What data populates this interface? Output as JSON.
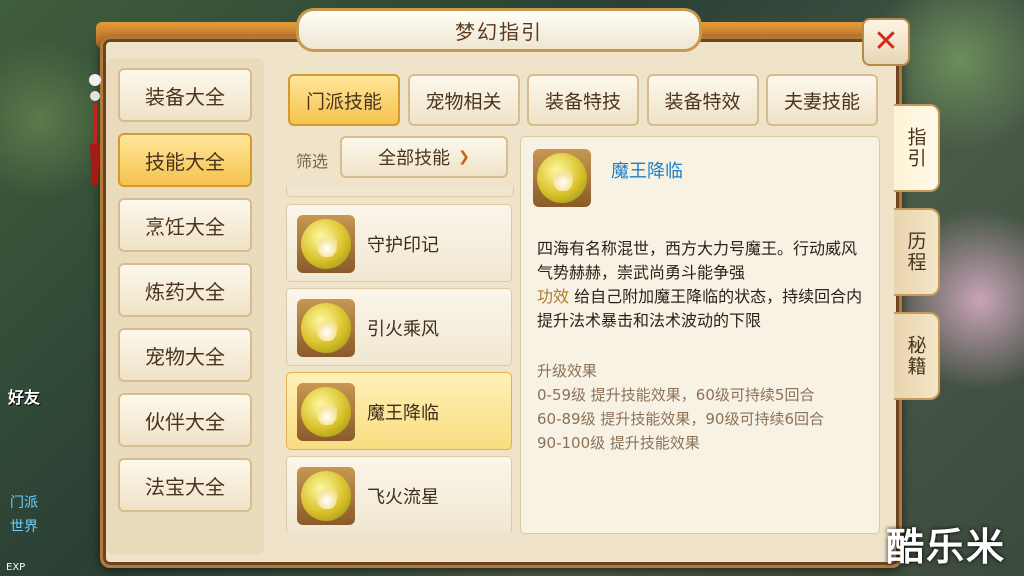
{
  "window": {
    "title": "梦幻指引",
    "close_label": "✕"
  },
  "categories": [
    {
      "label": "装备大全",
      "active": false
    },
    {
      "label": "技能大全",
      "active": true
    },
    {
      "label": "烹饪大全",
      "active": false
    },
    {
      "label": "炼药大全",
      "active": false
    },
    {
      "label": "宠物大全",
      "active": false
    },
    {
      "label": "伙伴大全",
      "active": false
    },
    {
      "label": "法宝大全",
      "active": false
    }
  ],
  "tabs": [
    {
      "label": "门派技能",
      "active": true
    },
    {
      "label": "宠物相关",
      "active": false
    },
    {
      "label": "装备特技",
      "active": false
    },
    {
      "label": "装备特效",
      "active": false
    },
    {
      "label": "夫妻技能",
      "active": false
    }
  ],
  "filter": {
    "label": "筛选",
    "value": "全部技能"
  },
  "skills": [
    {
      "name": "守护印记",
      "active": false
    },
    {
      "name": "引火乘风",
      "active": false
    },
    {
      "name": "魔王降临",
      "active": true
    },
    {
      "name": "飞火流星",
      "active": false
    }
  ],
  "detail": {
    "name": "魔王降临",
    "description": "四海有名称混世，西方大力号魔王。行动威风气势赫赫，崇武尚勇斗能争强",
    "effect_key": "功效",
    "effect_text": " 给自己附加魔王降临的状态，持续回合内提升法术暴击和法术波动的下限",
    "upgrade_title": "升级效果",
    "upgrade_lines": [
      "0-59级 提升技能效果，60级可持续5回合",
      "60-89级 提升技能效果，90级可持续6回合",
      "90-100级 提升技能效果"
    ]
  },
  "side_tabs": [
    {
      "label": "指引",
      "active": true
    },
    {
      "label": "历程",
      "active": false
    },
    {
      "label": "秘籍",
      "active": false
    }
  ],
  "background": {
    "chat_channels": [
      "门派",
      "世界"
    ],
    "friend_label": "好友",
    "exp_label": "EXP"
  },
  "watermark": "酷乐米",
  "colors": {
    "accent": "#f5c24e",
    "skill_name": "#1e7fc4",
    "close": "#d4261f"
  }
}
